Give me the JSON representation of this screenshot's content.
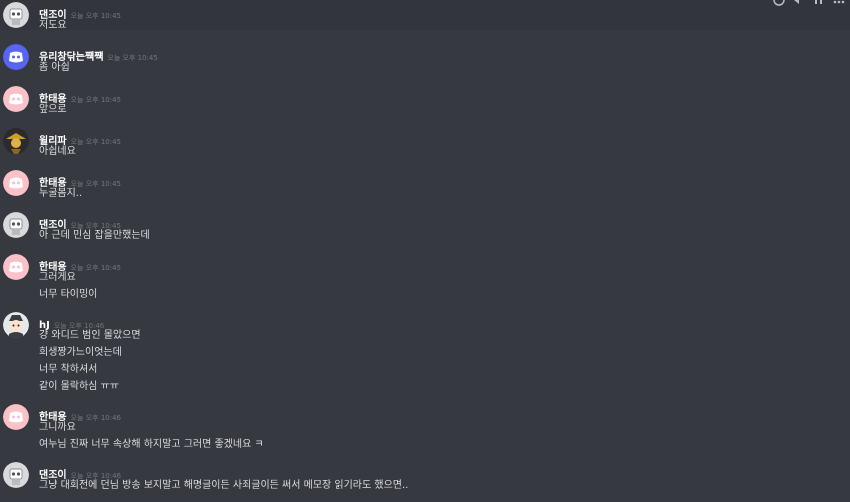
{
  "chat": {
    "messages": [
      {
        "author": "댄조이",
        "timestamp": "오늘 오후 10:45",
        "avatar": "robot-avatar",
        "lines": [
          "저도요"
        ]
      },
      {
        "author": "유리창닦는쨱쨱",
        "timestamp": "오늘 오후 10:45",
        "avatar": "discord-default-avatar",
        "lines": [
          "좀 아쉽"
        ]
      },
      {
        "author": "한태용",
        "timestamp": "오늘 오후 10:45",
        "avatar": "discord-default-avatar",
        "lines": [
          "앞으로"
        ]
      },
      {
        "author": "윌리파",
        "timestamp": "오늘 오후 10:45",
        "avatar": "character-avatar",
        "lines": [
          "아쉽네요"
        ]
      },
      {
        "author": "한태용",
        "timestamp": "오늘 오후 10:45",
        "avatar": "discord-default-avatar",
        "lines": [
          "누굴봄지.."
        ]
      },
      {
        "author": "댄조이",
        "timestamp": "오늘 오후 10:45",
        "avatar": "robot-avatar",
        "lines": [
          "아 근데 민심 잡을만했는데"
        ]
      },
      {
        "author": "한태용",
        "timestamp": "오늘 오후 10:45",
        "avatar": "discord-default-avatar",
        "lines": [
          "그러게요",
          "너무 타이밍이"
        ]
      },
      {
        "author": "hJ",
        "timestamp": "오늘 오후 10:46",
        "avatar": "cartoon-avatar",
        "lines": [
          "걍 와디드 범인 몰았으면",
          "희생짱가느이엇는데",
          "너무 착하셔서",
          "같이 몰락하심 ㅠㅠ"
        ]
      },
      {
        "author": "한태용",
        "timestamp": "오늘 오후 10:46",
        "avatar": "discord-default-avatar",
        "lines": [
          "그니까요",
          "여누님 진짜 너무 속상해 하지말고 그러면 좋겠네요 ㅋ"
        ]
      },
      {
        "author": "댄조이",
        "timestamp": "오늘 오후 10:46",
        "avatar": "robot-avatar",
        "lines": [
          "그냥 대회전에 던님 방송 보지말고 해명글이든 사죄글이든 써서 메모장 읽기라도 했으면.."
        ]
      }
    ]
  }
}
